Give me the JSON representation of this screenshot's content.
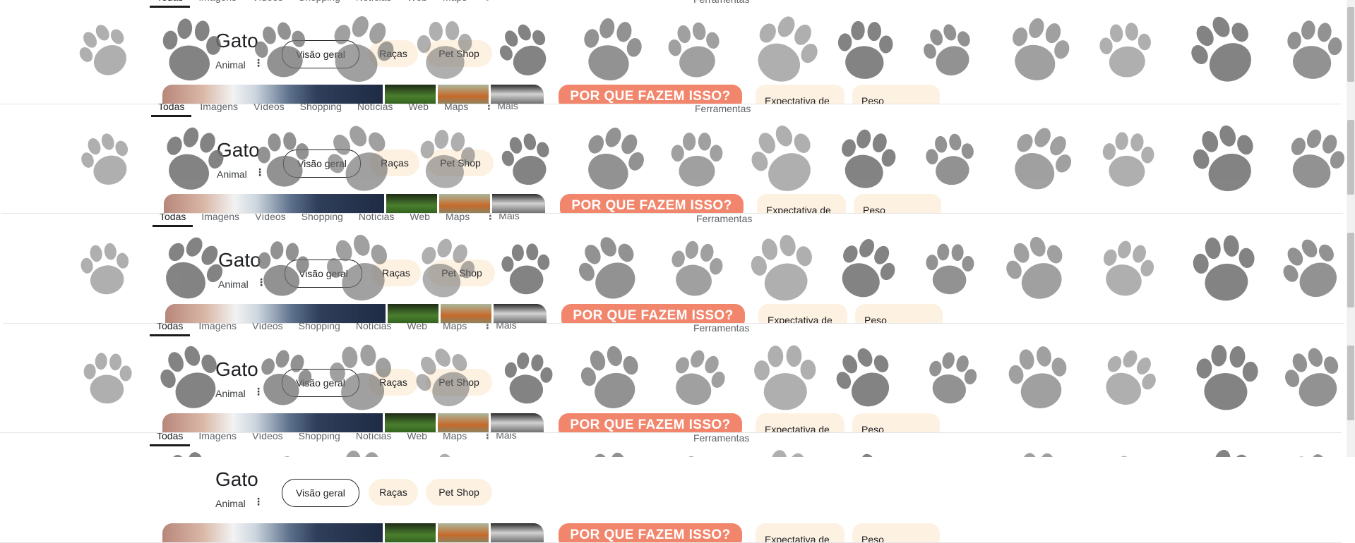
{
  "tabs": [
    "Todas",
    "Imagens",
    "Vídeos",
    "Shopping",
    "Notícias",
    "Web",
    "Maps",
    "Mais"
  ],
  "more_icon": "kebab-vertical-icon",
  "tools_label": "Ferramentas",
  "entity": {
    "title": "Gato",
    "subtitle": "Animal"
  },
  "chips": [
    "Visão geral",
    "Raças",
    "Pet Shop"
  ],
  "promo_text": "POR QUE FAZEM ISSO?",
  "cards": [
    "Expectativa de",
    "Peso"
  ],
  "decoration": {
    "paw_icon": "paw-print-icon",
    "paw_color": "#6e6e6e"
  },
  "colors": {
    "chip_bg": "#fdf1e2",
    "promo_bg": "#f2866d",
    "active_tab_underline": "#1a1a1a"
  }
}
